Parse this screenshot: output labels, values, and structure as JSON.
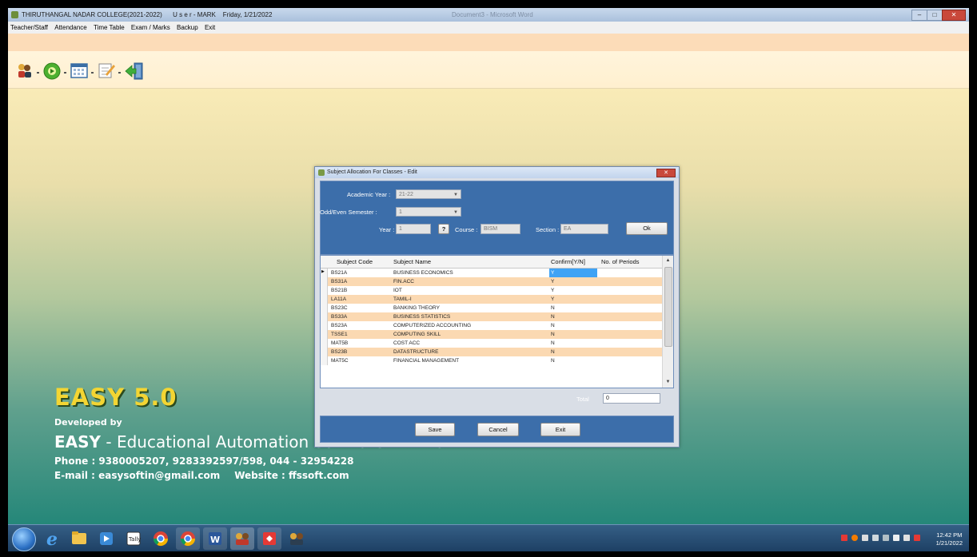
{
  "window": {
    "title": "THIRUTHANGAL NADAR COLLEGE(2021-2022)",
    "user": "U s e r - MARK",
    "date": "Friday, 1/21/2022",
    "background_doc": "Document3 - Microsoft Word",
    "buttons": [
      "minimize",
      "maximize",
      "close"
    ]
  },
  "menu": {
    "items": [
      "Teacher/Staff",
      "Attendance",
      "Time Table",
      "Exam / Marks",
      "Backup",
      "Exit"
    ]
  },
  "toolbar": {
    "icons": [
      "staff-icon",
      "attendance-icon",
      "calendar-icon",
      "exam-icon",
      "exit-icon"
    ]
  },
  "branding": {
    "title": "EASY 5.0",
    "developed_by": "Developed by",
    "company_name": "EASY",
    "company_rest": " - Educational Automation Software Pvt Ltd",
    "phone": "Phone : 9380005207, 9283392597/598,  044 - 32954228",
    "email": "E-mail : easysoftin@gmail.com",
    "website": "Website : ffssoft.com"
  },
  "dialog": {
    "title": "Subject Allocation For Classes - Edit",
    "academic_year_label": "Academic Year :",
    "academic_year_value": "21-22",
    "semester_label": "Odd/Even Semester :",
    "semester_value": "1",
    "year_label": "Year :",
    "year_value": "1",
    "help_button": "?",
    "course_label": "Course :",
    "course_value": "BISM",
    "section_label": "Section :",
    "section_value": "EA",
    "ok_button": "Ok",
    "grid": {
      "columns": [
        "Subject Code",
        "Subject Name",
        "Confirm[Y/N]",
        "No. of Periods"
      ],
      "rows": [
        {
          "code": "BS21A",
          "name": "BUSINESS ECONOMICS",
          "confirm": "Y",
          "periods": ""
        },
        {
          "code": "BS31A",
          "name": "FIN.ACC",
          "confirm": "Y",
          "periods": ""
        },
        {
          "code": "BS21B",
          "name": "IOT",
          "confirm": "Y",
          "periods": ""
        },
        {
          "code": "LA11A",
          "name": "TAMIL-I",
          "confirm": "Y",
          "periods": ""
        },
        {
          "code": "BS23C",
          "name": "BANKING THEORY",
          "confirm": "N",
          "periods": ""
        },
        {
          "code": "BS33A",
          "name": "BUSINESS STATISTICS",
          "confirm": "N",
          "periods": ""
        },
        {
          "code": "BS23A",
          "name": "COMPUTERIZED ACCOUNTING",
          "confirm": "N",
          "periods": ""
        },
        {
          "code": "TSSE1",
          "name": "COMPUTING SKILL",
          "confirm": "N",
          "periods": ""
        },
        {
          "code": "MAT5B",
          "name": "COST ACC",
          "confirm": "N",
          "periods": ""
        },
        {
          "code": "BS23B",
          "name": "DATASTRUCTURE",
          "confirm": "N",
          "periods": ""
        },
        {
          "code": "MAT5C",
          "name": "FINANCIAL MANAGEMENT",
          "confirm": "N",
          "periods": ""
        }
      ]
    },
    "total_label": "Total",
    "total_value": "0",
    "save_button": "Save",
    "cancel_button": "Cancel",
    "exit_button": "Exit"
  },
  "taskbar": {
    "time": "12:42 PM",
    "date": "1/21/2022",
    "apps": [
      "start",
      "internet-explorer",
      "file-explorer",
      "media-player",
      "tally",
      "chrome",
      "chrome-alt",
      "word",
      "easy-app",
      "anydesk",
      "easy-app-2"
    ]
  },
  "colors": {
    "dialog_panel": "#3c6eaa",
    "alt_row": "#fbd9b2",
    "selection": "#3fa3f5",
    "brand_yellow": "#f3d533"
  }
}
